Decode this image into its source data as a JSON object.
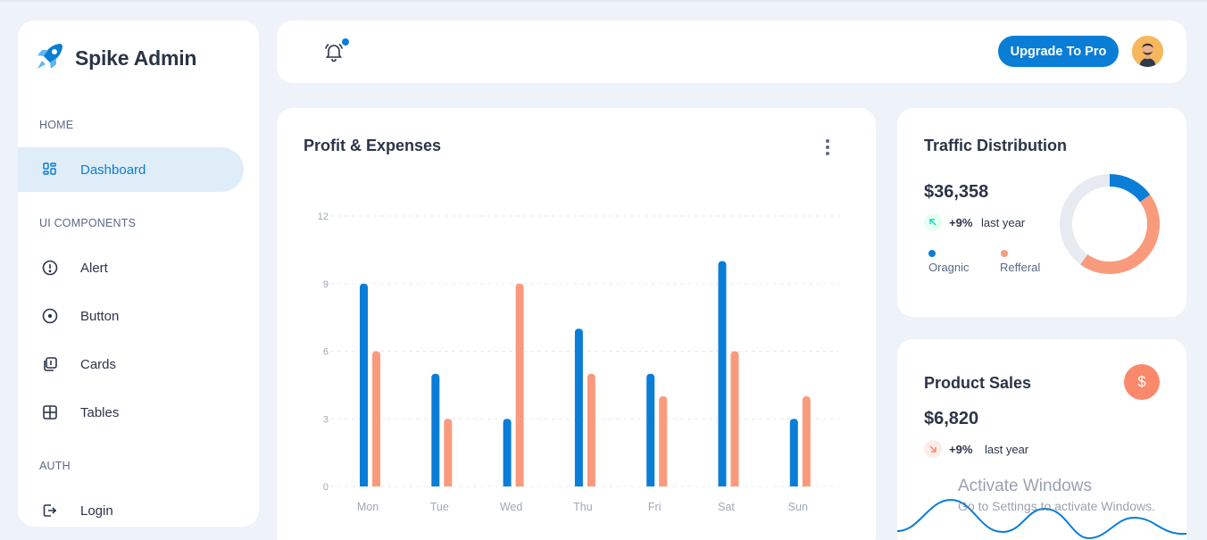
{
  "brand": {
    "name": "Spike Admin",
    "logo_icon": "rocket-icon"
  },
  "sidebar": {
    "sections": [
      {
        "title": "HOME",
        "items": [
          {
            "label": "Dashboard",
            "icon": "dashboard-icon",
            "active": true
          }
        ]
      },
      {
        "title": "UI COMPONENTS",
        "items": [
          {
            "label": "Alert",
            "icon": "alert-circle-icon"
          },
          {
            "label": "Button",
            "icon": "circle-dot-icon"
          },
          {
            "label": "Cards",
            "icon": "cards-icon"
          },
          {
            "label": "Tables",
            "icon": "table-icon"
          }
        ]
      },
      {
        "title": "AUTH",
        "items": [
          {
            "label": "Login",
            "icon": "login-icon"
          }
        ]
      }
    ]
  },
  "header": {
    "notification_icon": "bell-icon",
    "upgrade_label": "Upgrade To Pro",
    "avatar_icon": "user-avatar"
  },
  "profit_card": {
    "title": "Profit & Expenses",
    "menu_icon": "more-vertical-icon"
  },
  "chart_data": {
    "type": "bar",
    "title": "Profit & Expenses",
    "categories": [
      "Mon",
      "Tue",
      "Wed",
      "Thu",
      "Fri",
      "Sat",
      "Sun"
    ],
    "series": [
      {
        "values": [
          9,
          5,
          3,
          7,
          5,
          10,
          3
        ],
        "color": "#0a7dd6"
      },
      {
        "values": [
          6,
          3,
          9,
          5,
          4,
          6,
          4
        ],
        "color": "#fa9a7d"
      }
    ],
    "yticks": [
      0,
      3,
      6,
      9,
      12
    ],
    "ylim": [
      0,
      12
    ],
    "grid": true,
    "grid_style": "dashed-horizontal"
  },
  "traffic": {
    "title": "Traffic Distribution",
    "amount": "$36,358",
    "trend_pct": "+9%",
    "trend_text": "last year",
    "trend_icon": "arrow-up-left-icon",
    "legend": [
      {
        "label": "Oragnic",
        "color": "#0a7dd6"
      },
      {
        "label": "Refferal",
        "color": "#fa9a7d"
      }
    ],
    "donut_segments": [
      {
        "name": "Oragnic",
        "fraction": 0.15,
        "color": "#0a7dd6"
      },
      {
        "name": "Refferal",
        "fraction": 0.45,
        "color": "#fa9a7d"
      },
      {
        "name": "remaining",
        "fraction": 0.4,
        "color": "#e6ebf1"
      }
    ]
  },
  "product_sales": {
    "title": "Product Sales",
    "amount": "$6,820",
    "trend_pct": "+9%",
    "trend_text": "last year",
    "trend_icon": "arrow-down-right-icon",
    "badge_icon": "dollar-icon",
    "badge_symbol": "$"
  },
  "watermark": {
    "title": "Activate Windows",
    "subtitle": "Go to Settings to activate Windows."
  },
  "colors": {
    "primary": "#0a7dd6",
    "secondary": "#fa9a7d",
    "background": "#eef3f9",
    "text": "#2a3547"
  }
}
